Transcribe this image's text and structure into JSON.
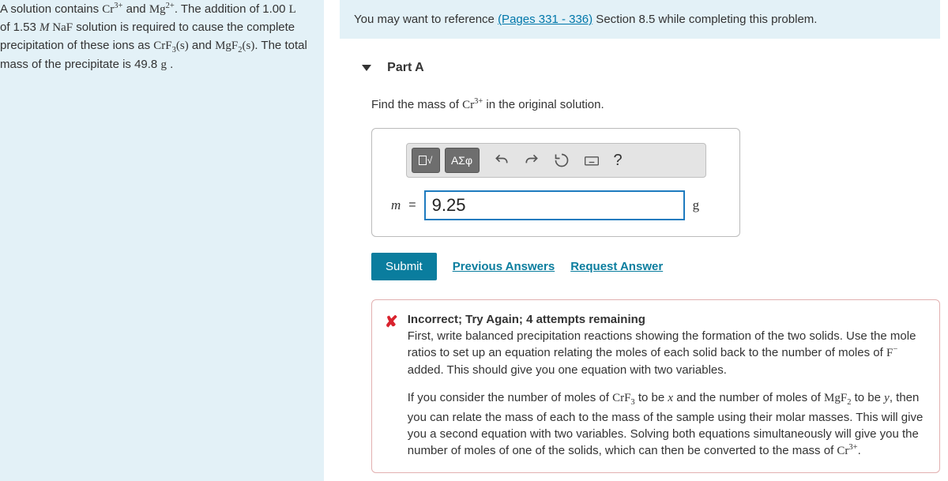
{
  "problem": {
    "p1a": "A solution contains ",
    "ion1": "Cr",
    "ion1sup": "3+",
    "p1b": " and ",
    "ion2": "Mg",
    "ion2sup": "2+",
    "p1c": ". The addition of 1.00 ",
    "vol_unit": "L",
    "p1d": " of 1.53 ",
    "conc_unit": "M",
    "compound1": " NaF",
    "p1e": " solution is required to cause the complete precipitation of these ions as ",
    "solid1": "CrF",
    "solid1sub": "3",
    "state": "(s)",
    "p1f": " and ",
    "solid2": "MgF",
    "solid2sub": "2",
    "p1g": ". The total mass of the precipitate is 49.8 ",
    "mass_unit": "g",
    "p1h": " ."
  },
  "reference": {
    "prefix": "You may want to reference ",
    "link": "(Pages 331 - 336)",
    "suffix": " Section 8.5 while completing this problem."
  },
  "part": {
    "label": "Part A",
    "prompt_a": "Find the mass of ",
    "prompt_ion": "Cr",
    "prompt_sup": "3+",
    "prompt_b": " in the original solution."
  },
  "toolbar": {
    "greek": "ΑΣφ",
    "help": "?"
  },
  "answer": {
    "var": "m",
    "eq": "=",
    "value": "9.25",
    "unit": "g"
  },
  "actions": {
    "submit": "Submit",
    "prev": "Previous Answers",
    "request": "Request Answer"
  },
  "feedback": {
    "head": "Incorrect; Try Again; 4 attempts remaining",
    "p1a": "First, write balanced precipitation reactions showing the formation of the two solids. Use the mole ratios to set up an equation relating the moles of each solid back to the number of moles of ",
    "p1ion": "F",
    "p1sup": "−",
    "p1b": " added. This should give you one equation with two variables.",
    "p2a": "If you consider the number of moles of ",
    "p2s1": "CrF",
    "p2s1sub": "3",
    "p2b": " to be ",
    "p2x": "x",
    "p2c": " and the number of moles of ",
    "p2s2": "MgF",
    "p2s2sub": "2",
    "p2d": " to be ",
    "p2y": "y",
    "p2e": ", then you can relate the mass of each to the mass of the sample using their molar masses. This will give you a second equation with two variables. Solving both equations simultaneously will give you the number of moles of one of the solids, which can then be converted to the mass of ",
    "p2ion": "Cr",
    "p2sup": "3+",
    "p2f": "."
  }
}
